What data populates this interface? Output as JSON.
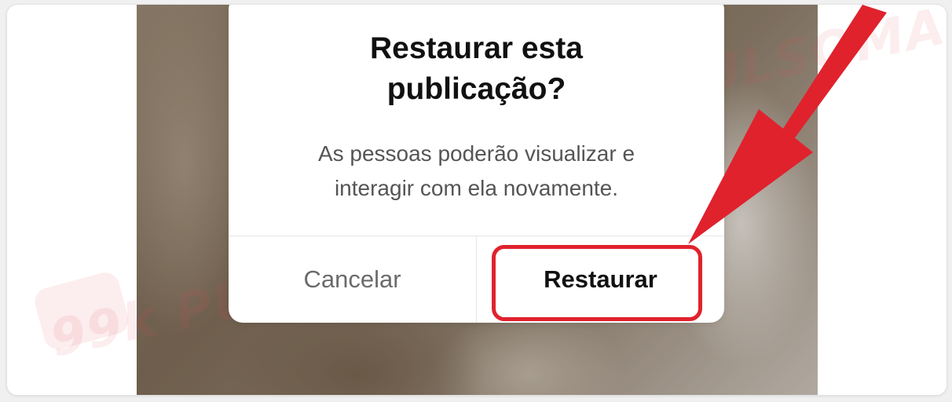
{
  "dialog": {
    "title_line1": "Restaurar esta",
    "title_line2": "publicação?",
    "message_line1": "As pessoas poderão visualizar e",
    "message_line2": "interagir com ela novamente.",
    "cancel_label": "Cancelar",
    "restore_label": "Restaurar"
  },
  "watermark": {
    "badge_text": "99k",
    "brand_text": "PULSOMAX"
  },
  "colors": {
    "annotation_red": "#e0222d",
    "title_text": "#111111",
    "body_text": "#555555",
    "cancel_text": "#6b6b6b"
  },
  "icons": {
    "annotation": "red-arrow-icon"
  }
}
